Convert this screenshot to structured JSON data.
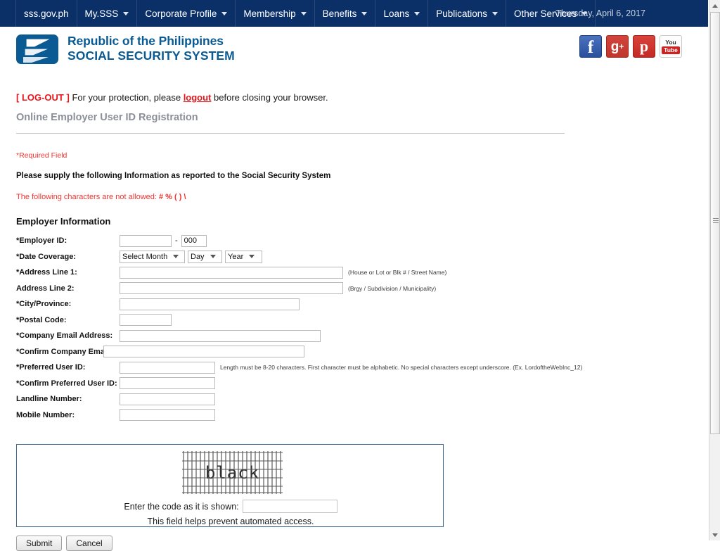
{
  "topnav": {
    "items": [
      {
        "label": "sss.gov.ph",
        "caret": false
      },
      {
        "label": "My.SSS",
        "caret": true
      },
      {
        "label": "Corporate Profile",
        "caret": true
      },
      {
        "label": "Membership",
        "caret": true
      },
      {
        "label": "Benefits",
        "caret": true
      },
      {
        "label": "Loans",
        "caret": true
      },
      {
        "label": "Publications",
        "caret": true
      },
      {
        "label": "Other Services",
        "caret": true
      }
    ],
    "date": "Thursday, April 6, 2017",
    "bg_color": "#0b3068"
  },
  "brand": {
    "line1": "Republic of the Philippines",
    "line2": "SOCIAL SECURITY SYSTEM",
    "color": "#0a5a93",
    "social": [
      {
        "name": "facebook",
        "label": "f"
      },
      {
        "name": "google-plus",
        "label": "g",
        "sup": "+"
      },
      {
        "name": "pinterest",
        "label": "p"
      },
      {
        "name": "youtube",
        "line1": "You",
        "line2": "Tube"
      }
    ]
  },
  "notice": {
    "tag": "[ LOG-OUT ]",
    "text_before": " For your protection, please ",
    "link": "logout",
    "text_after": " before closing your browser.",
    "tag_color": "#e8161a"
  },
  "page": {
    "title": "Online Employer User ID Registration",
    "required_note": "*Required Field",
    "supply_note": "Please supply the following Information as reported to the Social Security System",
    "chars_note_prefix": "The following characters are not allowed: ",
    "chars_note_chars": "# % ( ) \\",
    "section_title": "Employer Information"
  },
  "form": {
    "employer_id": {
      "label": "*Employer ID:",
      "value": "",
      "separator": "-",
      "suffix_value": "000"
    },
    "date_coverage": {
      "label": "*Date Coverage:",
      "month": "Select Month",
      "day": "Day",
      "year": "Year"
    },
    "address1": {
      "label": "*Address Line 1:",
      "value": "",
      "hint": "(House or Lot or Blk # / Street Name)"
    },
    "address2": {
      "label": "Address Line 2:",
      "value": "",
      "hint": "(Brgy / Subdivision / Municipality)"
    },
    "city_province": {
      "label": "*City/Province:",
      "value": ""
    },
    "postal_code": {
      "label": "*Postal Code:",
      "value": ""
    },
    "company_email": {
      "label": "*Company Email Address:",
      "value": ""
    },
    "confirm_company_email": {
      "label": "*Confirm Company Email Address:",
      "value": ""
    },
    "preferred_user_id": {
      "label": "*Preferred User ID:",
      "value": "",
      "hint": "Length must be 8-20 characters. First character must be alphabetic. No special characters except underscore. (Ex. LordoftheWebInc_12)"
    },
    "confirm_user_id": {
      "label": "*Confirm Preferred User ID:",
      "value": ""
    },
    "landline": {
      "label": "Landline Number:",
      "value": ""
    },
    "mobile": {
      "label": "Mobile Number:",
      "value": ""
    }
  },
  "captcha": {
    "code_text": "black",
    "prompt": "Enter the code as it is shown:",
    "input_value": "",
    "help": "This field helps prevent automated access.",
    "border_color": "#3d6a92"
  },
  "buttons": {
    "submit": "Submit",
    "cancel": "Cancel"
  }
}
